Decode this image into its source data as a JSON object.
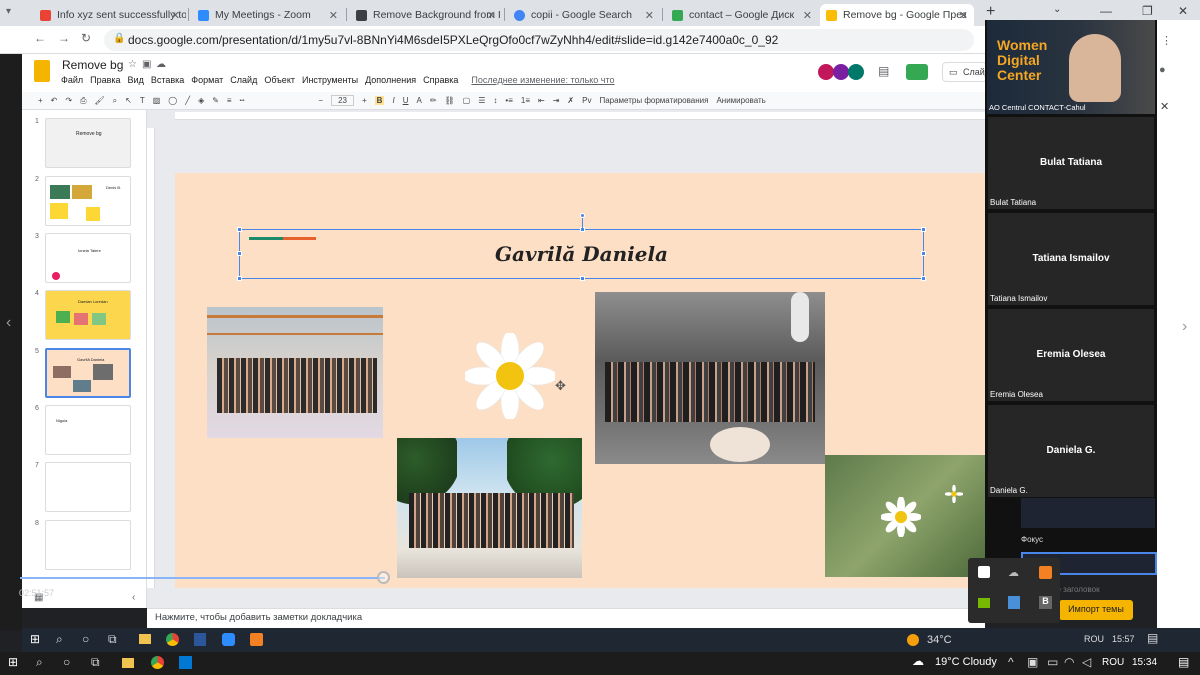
{
  "browser_tabs": [
    {
      "title": "Info xyz sent successfully to",
      "icon_color": "#ea4335"
    },
    {
      "title": "My Meetings - Zoom",
      "icon_color": "#2d8cff"
    },
    {
      "title": "Remove Background from I",
      "icon_color": "#3c4043"
    },
    {
      "title": "copii - Google Search",
      "icon_color": "#4285f4"
    },
    {
      "title": "contact – Google Диск",
      "icon_color": "#34a853"
    },
    {
      "title": "Remove bg - Google През",
      "icon_color": "#fbbc04",
      "active": true
    }
  ],
  "url": "docs.google.com/presentation/d/1my5u7vl-8BNnYi4M6sdeI5PXLeQrgOfo0cf7wZyNhh4/edit#slide=id.g142e7400a0c_0_92",
  "doc": {
    "title": "Remove bg",
    "menus": [
      "Файл",
      "Правка",
      "Вид",
      "Вставка",
      "Формат",
      "Слайд",
      "Объект",
      "Инструменты",
      "Дополнения",
      "Справка"
    ],
    "last_edit": "Последнее изменение: только что",
    "present_label": "Слайд"
  },
  "toolbar": {
    "font_size": "23",
    "format_options": "Параметры форматирования",
    "animate": "Анимировать"
  },
  "thumbnails": [
    {
      "num": "1",
      "text": "Remove bg"
    },
    {
      "num": "2",
      "text": "Denis B."
    },
    {
      "num": "3",
      "text": "Ionela Talere"
    },
    {
      "num": "4",
      "text": "Damian Loredan"
    },
    {
      "num": "5",
      "text": "Gavrilă Daniela"
    },
    {
      "num": "6",
      "text": "Nigula"
    },
    {
      "num": "7",
      "text": ""
    },
    {
      "num": "8",
      "text": ""
    }
  ],
  "slide": {
    "title": "Gavrilă Daniela",
    "bg": "#fddfc6"
  },
  "notes_placeholder": "Нажмите, чтобы добавить заметки докладчика",
  "video_time": "02:51:57",
  "zoom": {
    "speaker_org": "Women\nDigital\nCenter",
    "speaker_label": "AO Centrul CONTACT-Cahul",
    "participants": [
      {
        "name": "Bulat Tatiana",
        "label": "Bulat Tatiana"
      },
      {
        "name": "Tatiana Ismailov",
        "label": "Tatiana Ismailov"
      },
      {
        "name": "Eremia Olesea",
        "label": "Eremia Olesea"
      },
      {
        "name": "Daniela G.",
        "label": "Daniela G."
      }
    ]
  },
  "side_panel": {
    "focus": "Фокус",
    "placeholder": "Введите заголовок",
    "import_theme": "Импорт темы"
  },
  "inner_taskbar": {
    "weather": "34°C",
    "lang": "ROU",
    "time": "15:57"
  },
  "outer_taskbar": {
    "weather": "19°C Cloudy",
    "lang": "ROU",
    "time": "15:34"
  }
}
